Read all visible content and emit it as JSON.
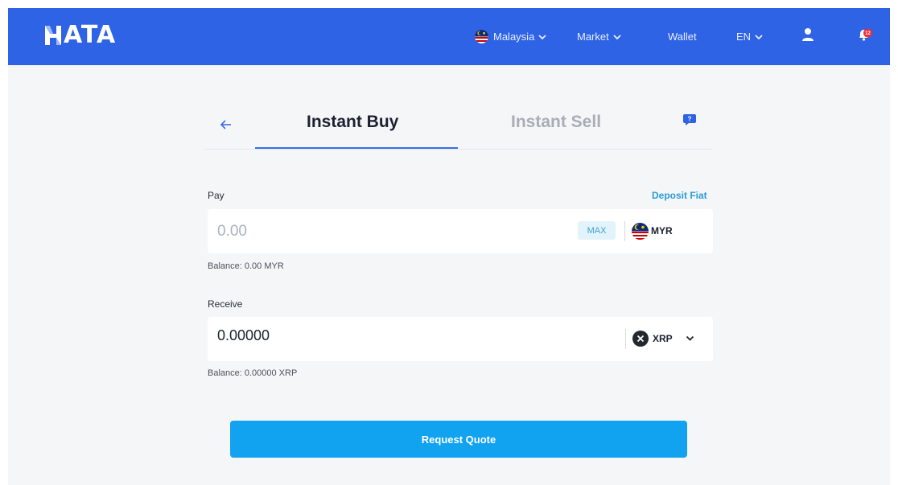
{
  "brand": {
    "name": "HATA",
    "accent": "#2e63e6",
    "button_color": "#11a2f0",
    "link_color": "#2b9bd8"
  },
  "header": {
    "country": "Malaysia",
    "market": "Market",
    "wallet": "Wallet",
    "language": "EN",
    "notification_count": "12"
  },
  "tabs": {
    "buy": "Instant Buy",
    "sell": "Instant Sell",
    "active": "Instant Buy"
  },
  "pay": {
    "label": "Pay",
    "deposit_link": "Deposit Fiat",
    "placeholder": "0.00",
    "max_label": "MAX",
    "currency": "MYR",
    "balance": "Balance: 0.00 MYR"
  },
  "receive": {
    "label": "Receive",
    "value": "0.00000",
    "currency": "XRP",
    "balance": "Balance: 0.00000 XRP"
  },
  "actions": {
    "request_quote": "Request Quote"
  },
  "icons": [
    "malaysia-flag-icon",
    "chevron-down-icon",
    "user-icon",
    "bell-icon",
    "back-arrow-icon",
    "help-chat-icon",
    "xrp-icon"
  ]
}
